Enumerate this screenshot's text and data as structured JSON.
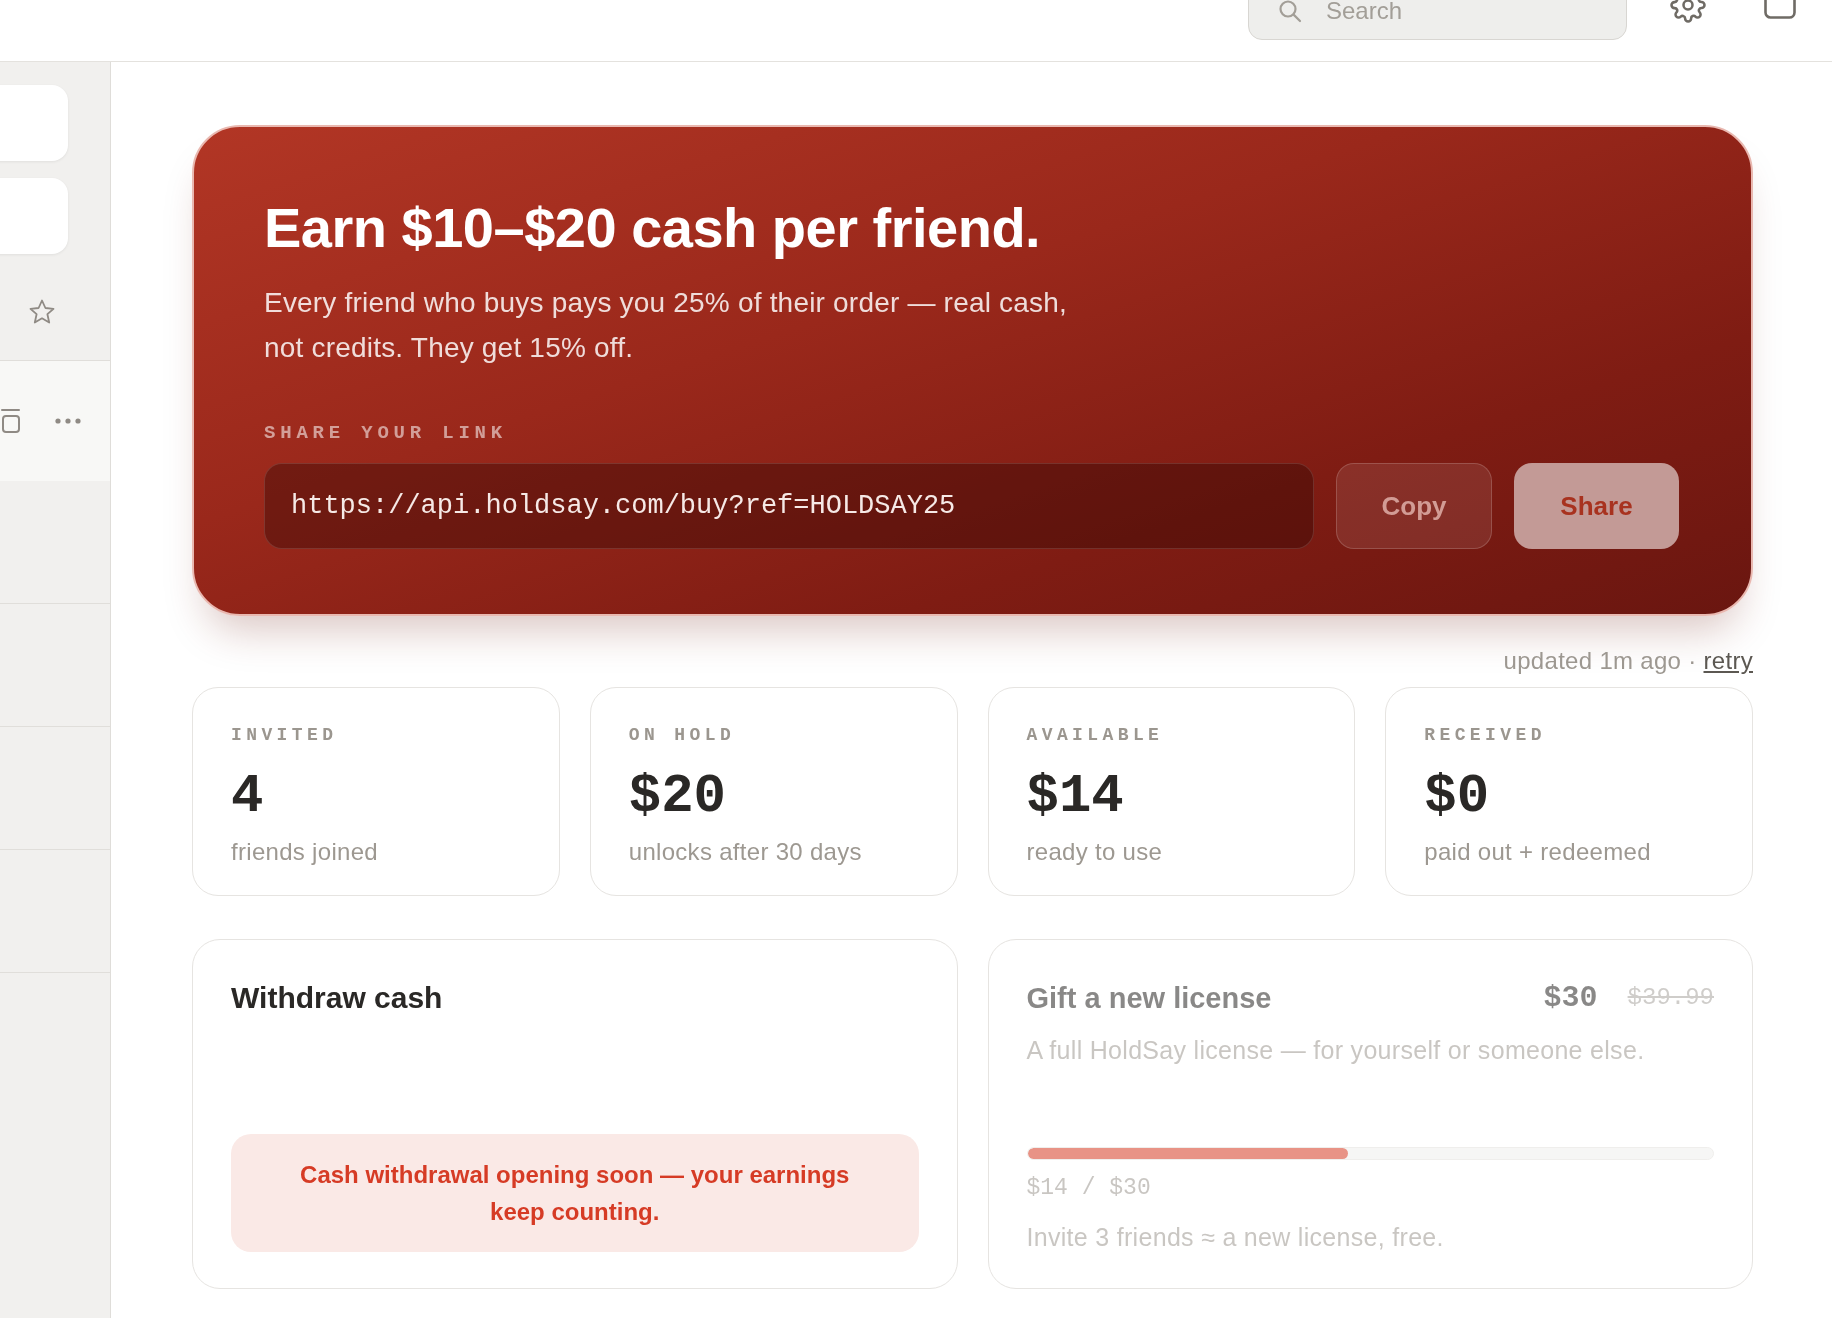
{
  "topbar": {
    "search": {
      "placeholder": "Search"
    }
  },
  "sidebar": {
    "rows": [
      {
        "selected": true
      },
      {
        "selected": false
      },
      {
        "selected": false
      },
      {
        "selected": false
      },
      {
        "selected": false
      }
    ]
  },
  "hero": {
    "title": "Earn $10–$20 cash per friend.",
    "description": "Every friend who buys pays you 25% of their order — real cash, not credits. They get 15% off.",
    "share_label": "SHARE YOUR LINK",
    "link": "https://api.holdsay.com/buy?ref=HOLDSAY25",
    "buttons": [
      {
        "label": "Copy",
        "kind": "secondary"
      },
      {
        "label": "Share",
        "kind": "primary"
      }
    ]
  },
  "status": {
    "text": "updated 1m ago ·",
    "link": "retry"
  },
  "stats": [
    {
      "label": "INVITED",
      "value": "4",
      "caption": "friends joined"
    },
    {
      "label": "ON HOLD",
      "value": "$20",
      "caption": "unlocks after 30 days"
    },
    {
      "label": "AVAILABLE",
      "value": "$14",
      "caption": "ready to use"
    },
    {
      "label": "RECEIVED",
      "value": "$0",
      "caption": "paid out + redeemed"
    }
  ],
  "withdraw": {
    "title": "Withdraw cash",
    "notice": "Cash withdrawal opening soon — your earnings keep counting."
  },
  "gift": {
    "title": "Gift a new license",
    "price": "$30",
    "old_price": "$39.99",
    "description": "A full HoldSay license — for yourself or someone else.",
    "level": 0.467,
    "progress_text": "$14 / $30",
    "hint": "Invite 3 friends ≈ a new license, free.",
    "disabled": true
  }
}
